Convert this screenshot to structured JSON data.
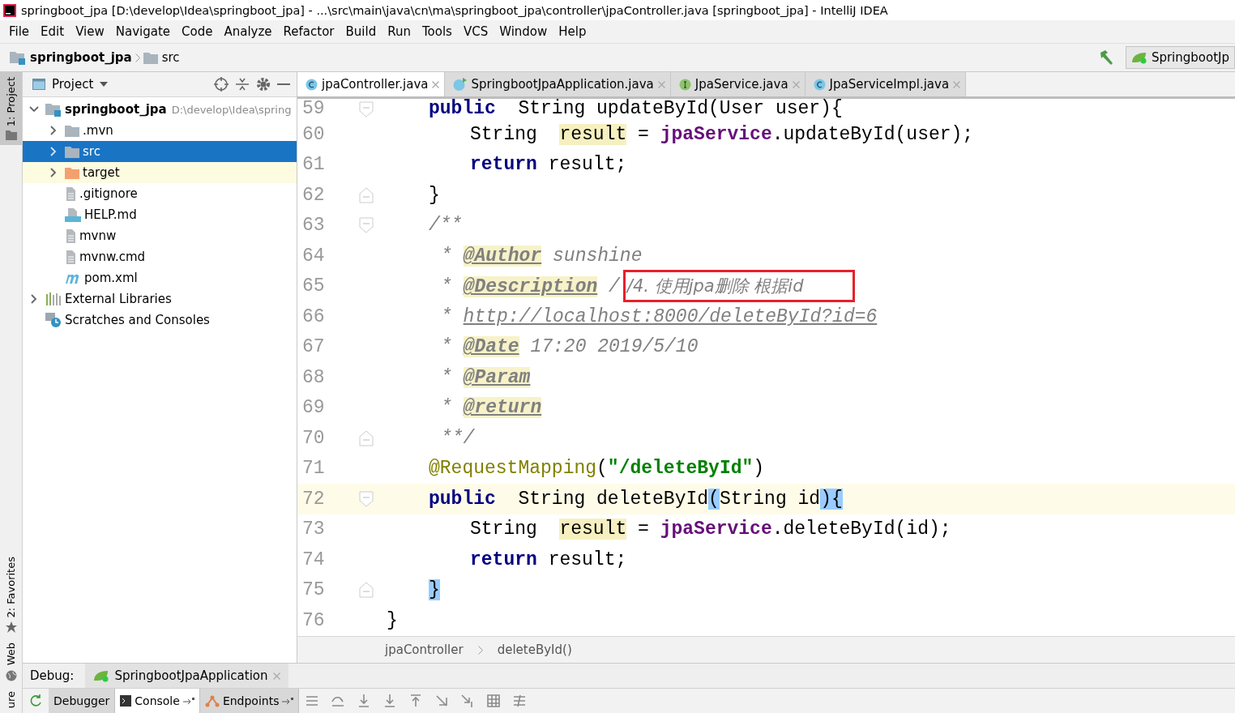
{
  "window": {
    "title": "springboot_jpa [D:\\develop\\Idea\\springboot_jpa] - ...\\src\\main\\java\\cn\\ma\\springboot_jpa\\controller\\jpaController.java [springboot_jpa] - IntelliJ IDEA"
  },
  "menu": [
    {
      "label": "File"
    },
    {
      "label": "Edit"
    },
    {
      "label": "View"
    },
    {
      "label": "Navigate"
    },
    {
      "label": "Code"
    },
    {
      "label": "Analyze"
    },
    {
      "label": "Refactor"
    },
    {
      "label": "Build"
    },
    {
      "label": "Run"
    },
    {
      "label": "Tools"
    },
    {
      "label": "VCS"
    },
    {
      "label": "Window"
    },
    {
      "label": "Help"
    }
  ],
  "breadcrumbs": [
    {
      "label": "springboot_jpa",
      "kind": "module"
    },
    {
      "label": "src",
      "kind": "folder"
    }
  ],
  "run_config": {
    "label": "SpringbootJp"
  },
  "side_strip": [
    {
      "label": "1: Project",
      "selected": true,
      "kind": "top"
    },
    {
      "label": "2: Favorites",
      "selected": false,
      "kind": "bottom"
    },
    {
      "label": "Web",
      "selected": false,
      "kind": "bottom"
    },
    {
      "label": "ure",
      "selected": false,
      "kind": "bottom"
    }
  ],
  "project_panel": {
    "title": "Project",
    "tree": [
      {
        "label": "springboot_jpa",
        "path": "D:\\develop\\Idea\\spring",
        "kind": "module",
        "expanded": true,
        "selected": false,
        "children": [
          {
            "label": ".mvn",
            "kind": "folder",
            "expanded": false,
            "selected": false
          },
          {
            "label": "src",
            "kind": "folder",
            "expanded": false,
            "selected": true
          },
          {
            "label": "target",
            "kind": "excluded",
            "expanded": false,
            "selected": false
          },
          {
            "label": ".gitignore",
            "kind": "file",
            "selected": false
          },
          {
            "label": "HELP.md",
            "kind": "markdown",
            "selected": false
          },
          {
            "label": "mvnw",
            "kind": "file",
            "selected": false
          },
          {
            "label": "mvnw.cmd",
            "kind": "file",
            "selected": false
          },
          {
            "label": "pom.xml",
            "kind": "maven",
            "selected": false
          }
        ]
      },
      {
        "label": "External Libraries",
        "kind": "libraries",
        "expanded": false,
        "selected": false
      },
      {
        "label": "Scratches and Consoles",
        "kind": "scratches",
        "selected": false
      }
    ]
  },
  "editor_tabs": [
    {
      "label": "jpaController.java",
      "kind": "class",
      "selected": true
    },
    {
      "label": "SpringbootJpaApplication.java",
      "kind": "spring",
      "selected": false
    },
    {
      "label": "JpaService.java",
      "kind": "interface",
      "selected": false
    },
    {
      "label": "JpaServiceImpl.java",
      "kind": "class",
      "selected": false
    }
  ],
  "code_lines": [
    {
      "number": "59",
      "current": false,
      "fold_open": true,
      "fold_close": false,
      "kind": "method",
      "tokens": [
        {
          "kind": "keyword",
          "text": "public"
        },
        {
          "kind": "plain",
          "text": "  String updateById(User user){"
        }
      ]
    },
    {
      "number": "60",
      "current": false,
      "fold_open": false,
      "fold_close": false,
      "kind": "body",
      "tokens": [
        {
          "kind": "plain",
          "text": "String  "
        },
        {
          "kind": "highlight",
          "text": "result"
        },
        {
          "kind": "plain",
          "text": " = "
        },
        {
          "kind": "field",
          "text": "jpaService"
        },
        {
          "kind": "plain",
          "text": ".updateById(user);"
        }
      ]
    },
    {
      "number": "61",
      "current": false,
      "fold_open": false,
      "fold_close": false,
      "kind": "body",
      "tokens": [
        {
          "kind": "keyword",
          "text": "return"
        },
        {
          "kind": "plain",
          "text": " result;"
        }
      ]
    },
    {
      "number": "62",
      "current": false,
      "fold_open": false,
      "fold_close": true,
      "kind": "method",
      "tokens": [
        {
          "kind": "plain",
          "text": "}"
        }
      ]
    },
    {
      "number": "63",
      "current": false,
      "fold_open": true,
      "fold_close": false,
      "kind": "method",
      "tokens": [
        {
          "kind": "comment",
          "text": "/**"
        }
      ]
    },
    {
      "number": "64",
      "current": false,
      "fold_open": false,
      "fold_close": false,
      "kind": "doc",
      "tokens": [
        {
          "kind": "comment",
          "text": "* "
        },
        {
          "kind": "doctag",
          "text": "@Author"
        },
        {
          "kind": "comment",
          "text": " sunshine"
        }
      ]
    },
    {
      "number": "65",
      "current": false,
      "fold_open": false,
      "fold_close": false,
      "kind": "doc",
      "tokens": [
        {
          "kind": "comment",
          "text": "* "
        },
        {
          "kind": "doctag",
          "text": "@Description"
        },
        {
          "kind": "comment",
          "text": " /"
        },
        {
          "kind": "boxed",
          "text": "/4. 使用jpa删除 根据id"
        }
      ]
    },
    {
      "number": "66",
      "current": false,
      "fold_open": false,
      "fold_close": false,
      "kind": "doc",
      "tokens": [
        {
          "kind": "comment",
          "text": "* "
        },
        {
          "kind": "link",
          "text": "http://localhost:8000/deleteById?id=6"
        }
      ]
    },
    {
      "number": "67",
      "current": false,
      "fold_open": false,
      "fold_close": false,
      "kind": "doc",
      "tokens": [
        {
          "kind": "comment",
          "text": "* "
        },
        {
          "kind": "doctag",
          "text": "@Date"
        },
        {
          "kind": "comment",
          "text": " 17:20 2019/5/10"
        }
      ]
    },
    {
      "number": "68",
      "current": false,
      "fold_open": false,
      "fold_close": false,
      "kind": "doc",
      "tokens": [
        {
          "kind": "comment",
          "text": "* "
        },
        {
          "kind": "doctag",
          "text": "@Param"
        }
      ]
    },
    {
      "number": "69",
      "current": false,
      "fold_open": false,
      "fold_close": false,
      "kind": "doc",
      "tokens": [
        {
          "kind": "comment",
          "text": "* "
        },
        {
          "kind": "doctag",
          "text": "@return"
        }
      ]
    },
    {
      "number": "70",
      "current": false,
      "fold_open": false,
      "fold_close": true,
      "kind": "doc",
      "tokens": [
        {
          "kind": "comment",
          "text": "**/"
        }
      ]
    },
    {
      "number": "71",
      "current": false,
      "fold_open": false,
      "fold_close": false,
      "kind": "method",
      "tokens": [
        {
          "kind": "annotation",
          "text": "@RequestMapping"
        },
        {
          "kind": "plain",
          "text": "("
        },
        {
          "kind": "string",
          "text": "\"/deleteById\""
        },
        {
          "kind": "plain",
          "text": ")"
        }
      ]
    },
    {
      "number": "72",
      "current": true,
      "fold_open": true,
      "fold_close": false,
      "kind": "method",
      "tokens": [
        {
          "kind": "keyword",
          "text": "public"
        },
        {
          "kind": "plain",
          "text": "  String deleteById"
        },
        {
          "kind": "brace",
          "text": "("
        },
        {
          "kind": "plain",
          "text": "String id"
        },
        {
          "kind": "brace",
          "text": ")"
        },
        {
          "kind": "brace",
          "text": "{"
        }
      ]
    },
    {
      "number": "73",
      "current": false,
      "fold_open": false,
      "fold_close": false,
      "kind": "body",
      "tokens": [
        {
          "kind": "plain",
          "text": "String  "
        },
        {
          "kind": "highlight",
          "text": "result"
        },
        {
          "kind": "plain",
          "text": " = "
        },
        {
          "kind": "field",
          "text": "jpaService"
        },
        {
          "kind": "plain",
          "text": ".deleteById(id);"
        }
      ]
    },
    {
      "number": "74",
      "current": false,
      "fold_open": false,
      "fold_close": false,
      "kind": "body",
      "tokens": [
        {
          "kind": "keyword",
          "text": "return"
        },
        {
          "kind": "plain",
          "text": " result;"
        }
      ]
    },
    {
      "number": "75",
      "current": false,
      "fold_open": false,
      "fold_close": true,
      "kind": "method",
      "tokens": [
        {
          "kind": "brace",
          "text": "}"
        }
      ]
    },
    {
      "number": "76",
      "current": false,
      "fold_open": false,
      "fold_close": false,
      "kind": "class",
      "tokens": [
        {
          "kind": "plain",
          "text": "}"
        }
      ]
    }
  ],
  "editor_breadcrumbs": [
    "jpaController",
    "deleteById()"
  ],
  "debug": {
    "label": "Debug:",
    "session": "SpringbootJpaApplication",
    "tabs": [
      {
        "label": "Debugger",
        "kind": "plain",
        "selected": false
      },
      {
        "label": "Console",
        "kind": "console",
        "selected": true
      },
      {
        "label": "Endpoints",
        "kind": "endpoints",
        "selected": false
      }
    ]
  }
}
